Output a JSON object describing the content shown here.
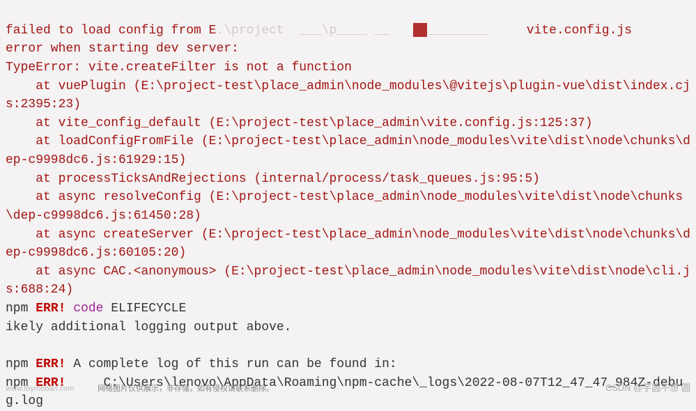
{
  "terminal": {
    "line1_pre": "failed to load config from E",
    "line1_faded": ".\\project  ___\\p____ __   ",
    "line1_post": "vite.config.js",
    "line2": "error when starting dev server:",
    "line3": "TypeError: vite.createFilter is not a function",
    "line4": "    at vuePlugin (E:\\project-test\\place_admin\\node_modules\\@vitejs\\plugin-vue\\dist\\index.cjs:2395:23)",
    "line5": "    at vite_config_default (E:\\project-test\\place_admin\\vite.config.js:125:37)",
    "line6": "    at loadConfigFromFile (E:\\project-test\\place_admin\\node_modules\\vite\\dist\\node\\chunks\\dep-c9998dc6.js:61929:15)",
    "line7": "    at processTicksAndRejections (internal/process/task_queues.js:95:5)",
    "line8": "    at async resolveConfig (E:\\project-test\\place_admin\\node_modules\\vite\\dist\\node\\chunks\\dep-c9998dc6.js:61450:28)",
    "line9": "    at async createServer (E:\\project-test\\place_admin\\node_modules\\vite\\dist\\node\\chunks\\dep-c9998dc6.js:60105:20)",
    "line10": "    at async CAC.<anonymous> (E:\\project-test\\place_admin\\node_modules\\vite\\dist\\node\\cli.js:688:24)",
    "npm_prefix": "npm ",
    "err_label": "ERR!",
    "code_label": " code",
    "elifecycle": " ELIFECYCLE",
    "ikely": "ikely additional logging output above.",
    "blank": "",
    "log_msg1": " A complete log of this run can be found in:",
    "log_msg2": "     C:\\Users\\lenovo\\AppData\\Roaming\\npm-cache\\_logs\\2022-08-07T12_47_47_984Z-debug.log"
  },
  "watermarks": {
    "left": "www.toymoban.com",
    "center": "网络图片仅供展示，非存储，如有侵权请联系删除。",
    "right": "CSDN @芋圆不想 圆"
  }
}
